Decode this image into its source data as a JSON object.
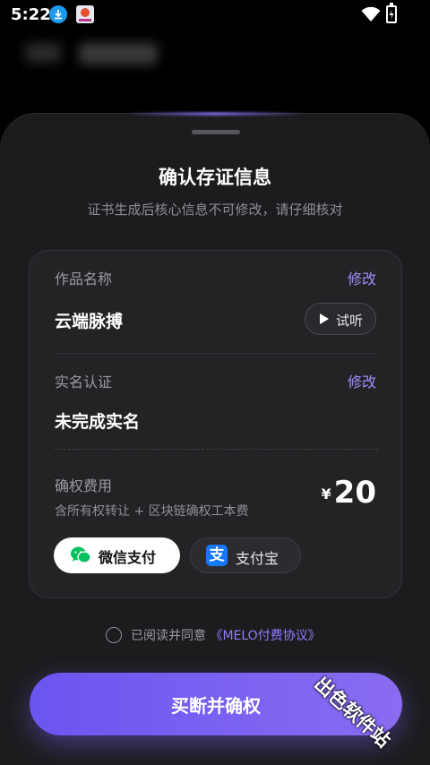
{
  "status_bar": {
    "time": "5:22"
  },
  "sheet": {
    "title": "确认存证信息",
    "subtitle": "证书生成后核心信息不可修改，请仔细核对",
    "work": {
      "label": "作品名称",
      "edit": "修改",
      "value": "云端脉搏",
      "listen": "试听"
    },
    "realname": {
      "label": "实名认证",
      "edit": "修改",
      "value": "未完成实名"
    },
    "fee": {
      "label": "确权费用",
      "description": "含所有权转让 + 区块链确权工本费",
      "currency": "¥",
      "amount": "20"
    },
    "payment": {
      "wechat": "微信支付",
      "alipay": "支付宝",
      "alipay_icon_text": "支",
      "selected": "wechat"
    },
    "agreement": {
      "prefix": "已阅读并同意",
      "link": "《MELO付费协议》",
      "checked": false
    },
    "cta": "买断并确权"
  },
  "watermark": "出色软件站",
  "colors": {
    "accent": "#a48dff",
    "cta_start": "#6b55f0",
    "cta_end": "#8a6cf2",
    "wechat_green": "#07c160",
    "alipay_blue": "#1677ff"
  }
}
